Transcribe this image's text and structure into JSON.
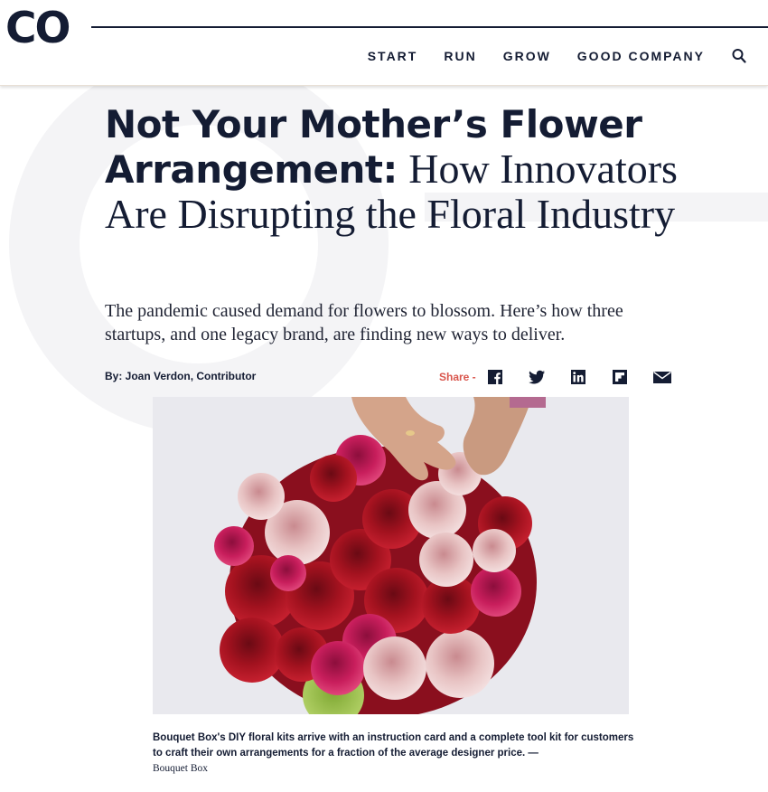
{
  "header": {
    "logo": "CO",
    "nav": [
      "START",
      "RUN",
      "GROW",
      "GOOD COMPANY"
    ],
    "search_icon": "search-icon"
  },
  "article": {
    "headline_bold": "Not Your Mother’s Flower Arrangement:",
    "headline_light": "How Innovators Are Disrupting the Floral Industry",
    "dek": "The pandemic caused demand for flowers to blossom. Here’s how three startups, and one legacy brand, are finding new ways to deliver.",
    "byline": "By: Joan Verdon, Contributor",
    "share_label": "Share -",
    "share_icons": [
      "facebook-icon",
      "twitter-icon",
      "linkedin-icon",
      "flipboard-icon",
      "email-icon"
    ],
    "caption": "Bouquet Box's DIY floral kits arrive with an instruction card and a complete tool kit for customers to craft their own arrangements for a fraction of the average designer price. —",
    "credit": "Bouquet Box"
  },
  "colors": {
    "navy": "#141c33",
    "share_red": "#d9564d"
  }
}
